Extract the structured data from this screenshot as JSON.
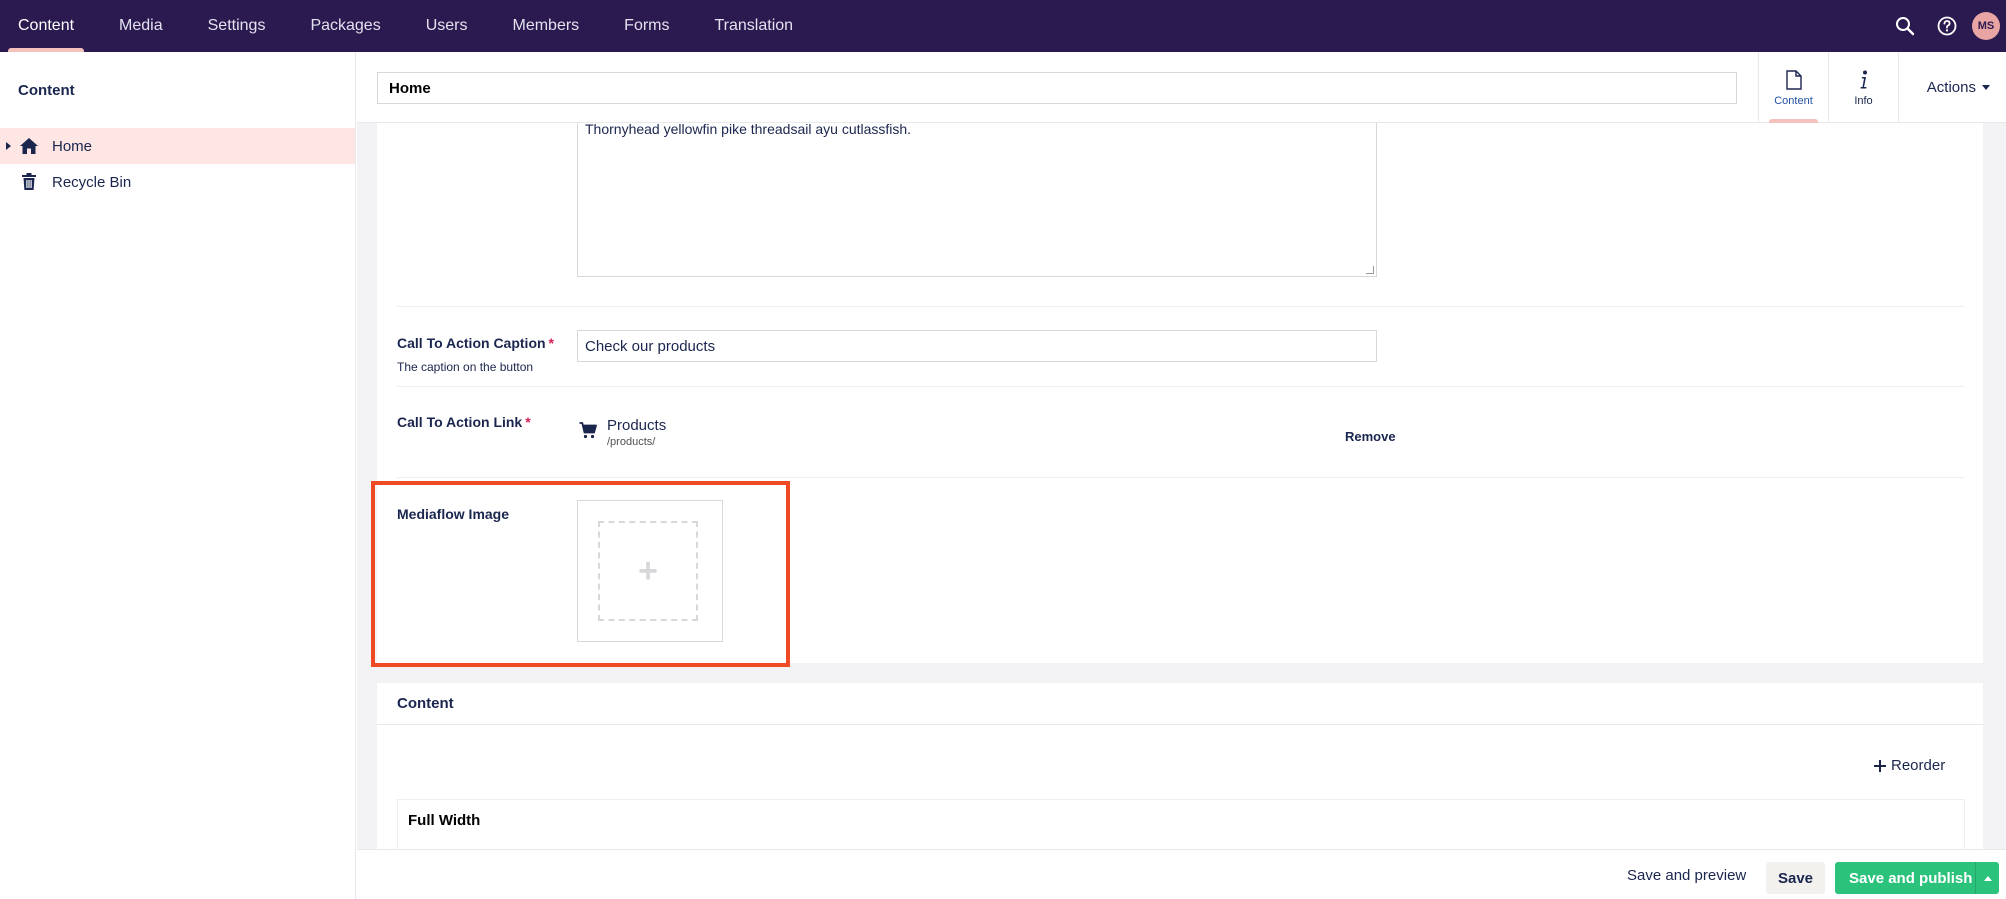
{
  "topnav": {
    "items": [
      "Content",
      "Media",
      "Settings",
      "Packages",
      "Users",
      "Members",
      "Forms",
      "Translation"
    ],
    "active": "Content",
    "icons": [
      "search-icon",
      "help-icon"
    ],
    "avatar_initials": "MS"
  },
  "sidebar": {
    "title": "Content",
    "items": [
      {
        "label": "Home",
        "icon": "home-icon",
        "active": true
      },
      {
        "label": "Recycle Bin",
        "icon": "trash-icon",
        "active": false
      }
    ]
  },
  "header": {
    "name": "Home",
    "tabs": [
      {
        "label": "Content",
        "icon": "document-icon",
        "active": true
      },
      {
        "label": "Info",
        "icon": "info-icon",
        "active": false
      }
    ],
    "actions_label": "Actions"
  },
  "properties": {
    "textarea_value": "Thornyhead yellowfin pike threadsail ayu cutlassfish.",
    "cta_caption": {
      "label": "Call To Action Caption",
      "required_mark": "*",
      "description": "The caption on the button",
      "value": "Check our products"
    },
    "cta_link": {
      "label": "Call To Action Link",
      "required_mark": "*",
      "link_name": "Products",
      "link_url": "/products/",
      "remove_label": "Remove"
    },
    "mediaflow": {
      "label": "Mediaflow Image",
      "add_symbol": "+"
    }
  },
  "content_group": {
    "title": "Content",
    "reorder_label": "Reorder",
    "block_label": "Full Width"
  },
  "footer": {
    "save_preview_label": "Save and preview",
    "save_label": "Save",
    "publish_label": "Save and publish"
  },
  "colors": {
    "topbar": "#2a1a4f",
    "accent": "#f5c1bc",
    "publish": "#2bc37c",
    "highlight": "#f04a24"
  }
}
